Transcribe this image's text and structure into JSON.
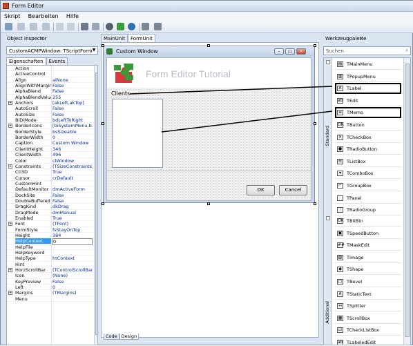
{
  "window": {
    "title": "Form Editor"
  },
  "menu": [
    "Skript",
    "Bearbeiten",
    "Hilfe"
  ],
  "object_inspector": {
    "title": "Object Inspector",
    "selected_object": "CustomACMPWindow: TScriptForm",
    "tabs": [
      "Eigenschaften",
      "Events"
    ],
    "properties": [
      {
        "name": "Action",
        "value": ""
      },
      {
        "name": "ActiveControl",
        "value": ""
      },
      {
        "name": "Align",
        "value": "alNone"
      },
      {
        "name": "AlignWithMargins",
        "value": "False"
      },
      {
        "name": "AlphaBlend",
        "value": "False"
      },
      {
        "name": "AlphaBlendValue",
        "value": "255"
      },
      {
        "name": "Anchors",
        "value": "[akLeft,akTop]",
        "expand": "+"
      },
      {
        "name": "AutoScroll",
        "value": "False"
      },
      {
        "name": "AutoSize",
        "value": "False"
      },
      {
        "name": "BiDiMode",
        "value": "bdLeftToRight"
      },
      {
        "name": "BorderIcons",
        "value": "[biSystemMenu,b...",
        "expand": "+"
      },
      {
        "name": "BorderStyle",
        "value": "bsSizeable"
      },
      {
        "name": "BorderWidth",
        "value": "0"
      },
      {
        "name": "Caption",
        "value": "Custom Window"
      },
      {
        "name": "ClientHeight",
        "value": "346"
      },
      {
        "name": "ClientWidth",
        "value": "496"
      },
      {
        "name": "Color",
        "value": "clWindow"
      },
      {
        "name": "Constraints",
        "value": "(TSizeConstraints)",
        "expand": "+"
      },
      {
        "name": "Ctl3D",
        "value": "True"
      },
      {
        "name": "Cursor",
        "value": "crDefault"
      },
      {
        "name": "CustomHint",
        "value": ""
      },
      {
        "name": "DefaultMonitor",
        "value": "dmActiveForm"
      },
      {
        "name": "DockSite",
        "value": "False"
      },
      {
        "name": "DoubleBuffered",
        "value": "False"
      },
      {
        "name": "DragKind",
        "value": "dkDrag"
      },
      {
        "name": "DragMode",
        "value": "dmManual"
      },
      {
        "name": "Enabled",
        "value": "True"
      },
      {
        "name": "Font",
        "value": "(TFont)",
        "expand": "+"
      },
      {
        "name": "FormStyle",
        "value": "fsStayOnTop"
      },
      {
        "name": "Height",
        "value": "384"
      },
      {
        "name": "HelpContext",
        "value": "0",
        "selected": true
      },
      {
        "name": "HelpFile",
        "value": ""
      },
      {
        "name": "HelpKeyword",
        "value": ""
      },
      {
        "name": "HelpType",
        "value": "htContext"
      },
      {
        "name": "Hint",
        "value": ""
      },
      {
        "name": "HorzScrollBar",
        "value": "(TControlScrollBar)",
        "expand": "+"
      },
      {
        "name": "Icon",
        "value": "(None)"
      },
      {
        "name": "KeyPreview",
        "value": "False"
      },
      {
        "name": "Left",
        "value": "0"
      },
      {
        "name": "Margins",
        "value": "(TMargins)",
        "expand": "+"
      },
      {
        "name": "Menu",
        "value": ""
      }
    ]
  },
  "editor": {
    "tabs": [
      "MainUnit",
      "FormUnit"
    ],
    "bottom_tabs": [
      "Code",
      "Design"
    ],
    "custom_window": {
      "title": "Custom Window",
      "banner_text": "Form Editor Tutorial",
      "label": "Clients",
      "ok": "OK",
      "cancel": "Cancel"
    }
  },
  "palette": {
    "title": "Werkzeugpalette",
    "search_placeholder": "Suchen",
    "categories": [
      "Standard",
      "Additional"
    ],
    "standard": [
      {
        "name": "TMainMenu",
        "icon": "main-menu-icon",
        "glyph": "▤"
      },
      {
        "name": "TPopupMenu",
        "icon": "popup-menu-icon",
        "glyph": "▥"
      },
      {
        "name": "TLabel",
        "icon": "label-icon",
        "glyph": "A",
        "highlight": true
      },
      {
        "name": "TEdit",
        "icon": "edit-icon",
        "glyph": "ab"
      },
      {
        "name": "TMemo",
        "icon": "memo-icon",
        "glyph": "≡",
        "highlight": true
      },
      {
        "name": "TButton",
        "icon": "button-icon",
        "glyph": "OK"
      },
      {
        "name": "TCheckBox",
        "icon": "checkbox-icon",
        "glyph": "✕"
      },
      {
        "name": "TRadioButton",
        "icon": "radio-icon",
        "glyph": "●"
      },
      {
        "name": "TListBox",
        "icon": "listbox-icon",
        "glyph": "☰"
      },
      {
        "name": "TComboBox",
        "icon": "combobox-icon",
        "glyph": "▾"
      },
      {
        "name": "TGroupBox",
        "icon": "groupbox-icon",
        "glyph": "⌐"
      },
      {
        "name": "TPanel",
        "icon": "panel-icon",
        "glyph": " "
      },
      {
        "name": "TRadioGroup",
        "icon": "radiogroup-icon",
        "glyph": "⋮"
      }
    ],
    "additional": [
      {
        "name": "TBitBtn",
        "icon": "bitbtn-icon",
        "glyph": "OK"
      },
      {
        "name": "TSpeedButton",
        "icon": "speedbutton-icon",
        "glyph": "▣"
      },
      {
        "name": "TMaskEdit",
        "icon": "maskedit-icon",
        "glyph": "##"
      },
      {
        "name": "TImage",
        "icon": "image-icon",
        "glyph": "▨"
      },
      {
        "name": "TShape",
        "icon": "shape-icon",
        "glyph": "◆"
      },
      {
        "name": "TBevel",
        "icon": "bevel-icon",
        "glyph": "□"
      },
      {
        "name": "TStaticText",
        "icon": "statictext-icon",
        "glyph": "A"
      },
      {
        "name": "TSplitter",
        "icon": "splitter-icon",
        "glyph": "↔"
      },
      {
        "name": "TScrollBox",
        "icon": "scrollbox-icon",
        "glyph": "▦"
      },
      {
        "name": "TCheckListBox",
        "icon": "checklistbox-icon",
        "glyph": "☑"
      },
      {
        "name": "TLabeledEdit",
        "icon": "labelededit-icon",
        "glyph": "ab"
      }
    ]
  }
}
